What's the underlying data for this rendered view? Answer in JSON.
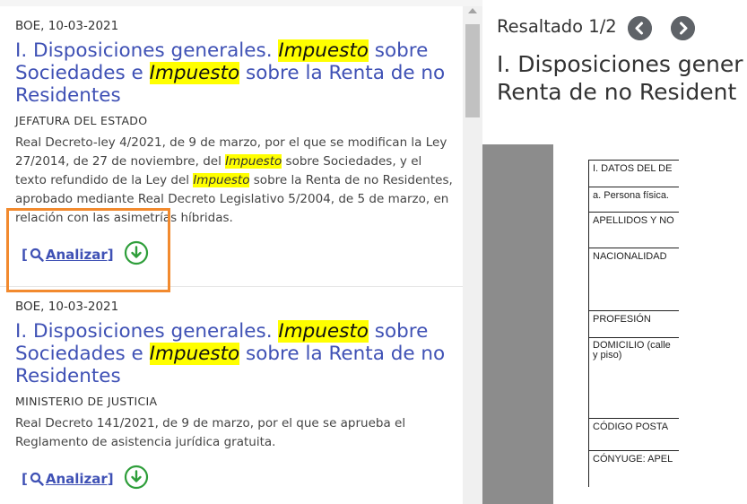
{
  "results": [
    {
      "date": "BOE, 10-03-2021",
      "title_parts": [
        "I. Disposiciones generales. ",
        "Impuesto",
        " sobre Sociedades e ",
        "Impuesto",
        " sobre la Renta de no Residentes"
      ],
      "organization": "JEFATURA DEL ESTADO",
      "description_parts": [
        "Real Decreto-ley 4/2021, de 9 de marzo, por el que se modifican la Ley 27/2014, de 27 de noviembre, del ",
        "Impuesto",
        " sobre Sociedades, y el texto refundido de la Ley del ",
        "Impuesto",
        " sobre la Renta de no Residentes, aprobado mediante Real Decreto Legislativo 5/2004, de 5 de marzo, en relación con las asimetrías híbridas."
      ],
      "analyze_label": "Analizar]",
      "analyze_open": "["
    },
    {
      "date": "BOE, 10-03-2021",
      "title_parts": [
        "I. Disposiciones generales. ",
        "Impuesto",
        " sobre Sociedades e ",
        "Impuesto",
        " sobre la Renta de no Residentes"
      ],
      "organization": "MINISTERIO DE JUSTICIA",
      "description": "Real Decreto 141/2021, de 9 de marzo, por el que se aprueba el Reglamento de asistencia jurídica gratuita.",
      "analyze_label": "Analizar]",
      "analyze_open": "["
    }
  ],
  "viewer": {
    "highlight_counter": "Resaltado 1/2",
    "title_line1": "I. Disposiciones gener",
    "title_line2": "Renta de no Resident",
    "form_rows": [
      "I. DATOS DEL DE",
      "a. Persona física.",
      "APELLIDOS Y NO",
      "NACIONALIDAD",
      "PROFESIÓN",
      "DOMICILIO (calle",
      "y piso)",
      "CÓDIGO POSTA",
      "CÓNYUGE: APEL"
    ]
  },
  "colors": {
    "link": "#3f51b5",
    "highlight": "#ffff00",
    "download": "#2e9e3a",
    "annotation": "#f28a2e"
  }
}
